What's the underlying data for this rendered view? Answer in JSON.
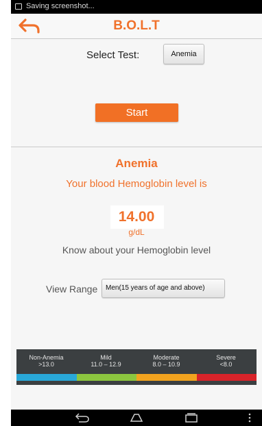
{
  "status_bar": {
    "notification": "Saving screenshot..."
  },
  "app_bar": {
    "title": "B.O.L.T"
  },
  "test_select": {
    "label": "Select Test:",
    "value": "Anemia"
  },
  "start_label": "Start",
  "result": {
    "title": "Anemia",
    "subtitle": "Your blood Hemoglobin level is",
    "value": "14.00",
    "unit": "g/dL",
    "info_link": "Know about your Hemoglobin level"
  },
  "range_select": {
    "label": "View Range",
    "value": "Men(15 years of age and above)"
  },
  "legend": [
    {
      "name": "Non-Anemia",
      "range": ">13.0",
      "color": "#29a8d8"
    },
    {
      "name": "Mild",
      "range": "11.0 – 12.9",
      "color": "#8cc63f"
    },
    {
      "name": "Moderate",
      "range": "8.0 – 10.9",
      "color": "#f2a31e"
    },
    {
      "name": "Severe",
      "range": "<8.0",
      "color": "#d8232a"
    }
  ],
  "colors": {
    "accent": "#f0712b",
    "button": "#f17025"
  }
}
